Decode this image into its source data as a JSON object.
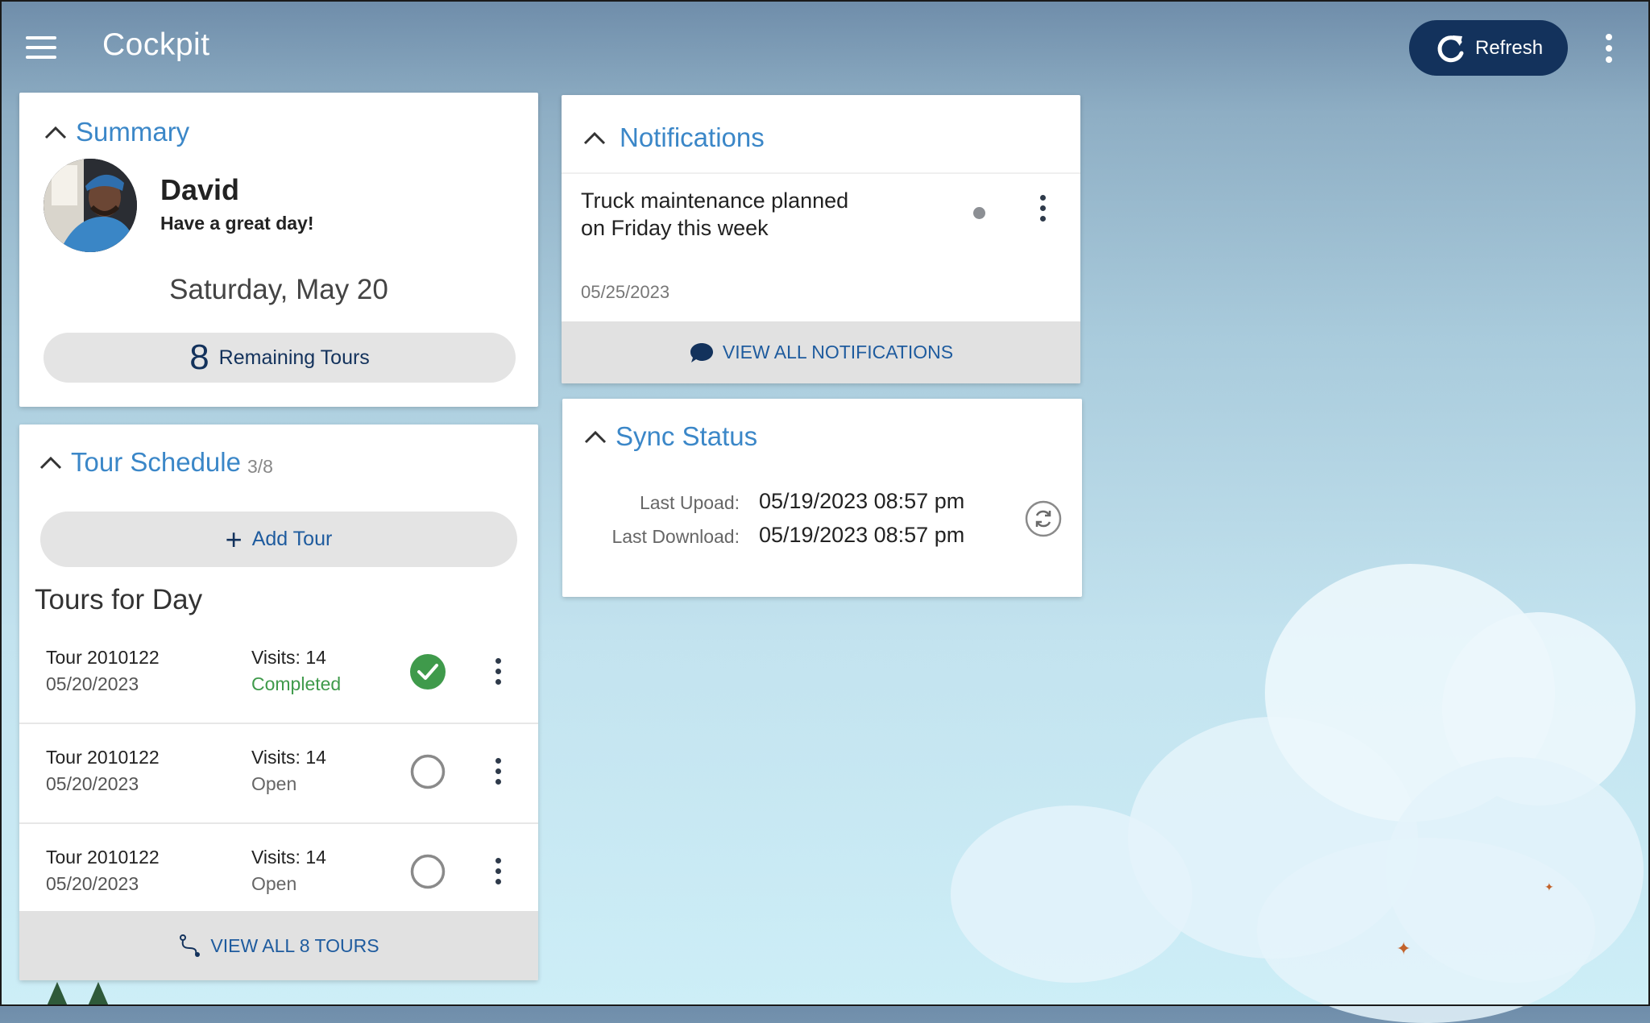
{
  "header": {
    "title": "Cockpit",
    "refresh_label": "Refresh"
  },
  "summary": {
    "title": "Summary",
    "user_name": "David",
    "greeting": "Have a great day!",
    "date": "Saturday, May 20",
    "remaining_count": "8",
    "remaining_label": "Remaining Tours"
  },
  "tour_schedule": {
    "title": "Tour Schedule",
    "count": "3/8",
    "add_label": "Add Tour",
    "day_title": "Tours for Day",
    "tours": [
      {
        "name": "Tour 2010122",
        "date": "05/20/2023",
        "visits": "Visits: 14",
        "status": "Completed",
        "completed": true
      },
      {
        "name": "Tour 2010122",
        "date": "05/20/2023",
        "visits": "Visits: 14",
        "status": "Open",
        "completed": false
      },
      {
        "name": "Tour 2010122",
        "date": "05/20/2023",
        "visits": "Visits: 14",
        "status": "Open",
        "completed": false
      }
    ],
    "view_all_label": "VIEW ALL 8 TOURS"
  },
  "notifications": {
    "title": "Notifications",
    "items": [
      {
        "text": "Truck maintenance planned on Friday this week",
        "date": "05/25/2023",
        "unread": true
      }
    ],
    "view_all_label": "VIEW ALL NOTIFICATIONS"
  },
  "sync_status": {
    "title": "Sync Status",
    "last_upload_label": "Last Upoad:",
    "last_upload_value": "05/19/2023 08:57 pm",
    "last_download_label": "Last Download:",
    "last_download_value": "05/19/2023 08:57 pm"
  },
  "colors": {
    "accent": "#3b87c8",
    "primary_dark": "#13325c",
    "success": "#3f9a4b"
  },
  "icons": [
    "hamburger-icon",
    "refresh-icon",
    "more-vert-icon",
    "chevron-up-icon",
    "plus-icon",
    "check-circle-icon",
    "empty-circle-icon",
    "route-icon",
    "chat-bubble-icon",
    "sync-icon"
  ]
}
